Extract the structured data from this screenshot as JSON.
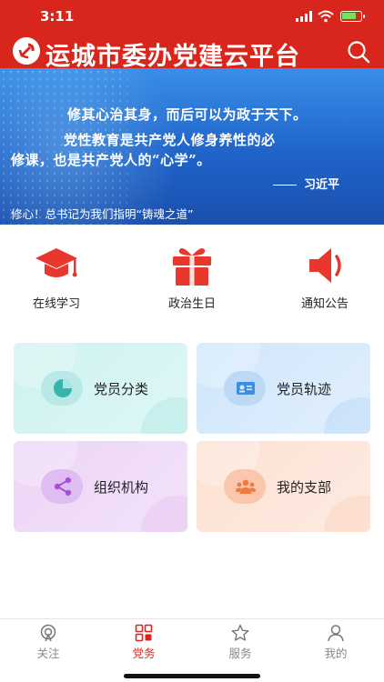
{
  "status": {
    "time": "3:11"
  },
  "header": {
    "title": "运城市委办党建云平台",
    "search_icon": "search-icon",
    "logo_icon": "party-emblem-icon"
  },
  "banner": {
    "quote_line1": "修其心治其身，而后可以为政于天下。",
    "quote_line2": "党性教育是共产党人修身养性的必",
    "quote_line3": "修课，也是共产党人的“心学”。",
    "author": "习近平",
    "caption": "修心！总书记为我们指明“铸魂之道”"
  },
  "quick_links": [
    {
      "label": "在线学习",
      "icon": "graduation-cap-icon"
    },
    {
      "label": "政治生日",
      "icon": "gift-icon"
    },
    {
      "label": "通知公告",
      "icon": "megaphone-icon"
    }
  ],
  "cards": [
    {
      "label": "党员分类",
      "icon": "pie-chart-icon"
    },
    {
      "label": "党员轨迹",
      "icon": "id-card-icon"
    },
    {
      "label": "组织机构",
      "icon": "share-icon"
    },
    {
      "label": "我的支部",
      "icon": "group-icon"
    }
  ],
  "tabs": [
    {
      "label": "关注",
      "icon": "broadcast-icon"
    },
    {
      "label": "党务",
      "icon": "grid-icon"
    },
    {
      "label": "服务",
      "icon": "star-icon"
    },
    {
      "label": "我的",
      "icon": "user-icon"
    }
  ],
  "colors": {
    "brand": "#d9261c",
    "tab_inactive": "#888888"
  }
}
